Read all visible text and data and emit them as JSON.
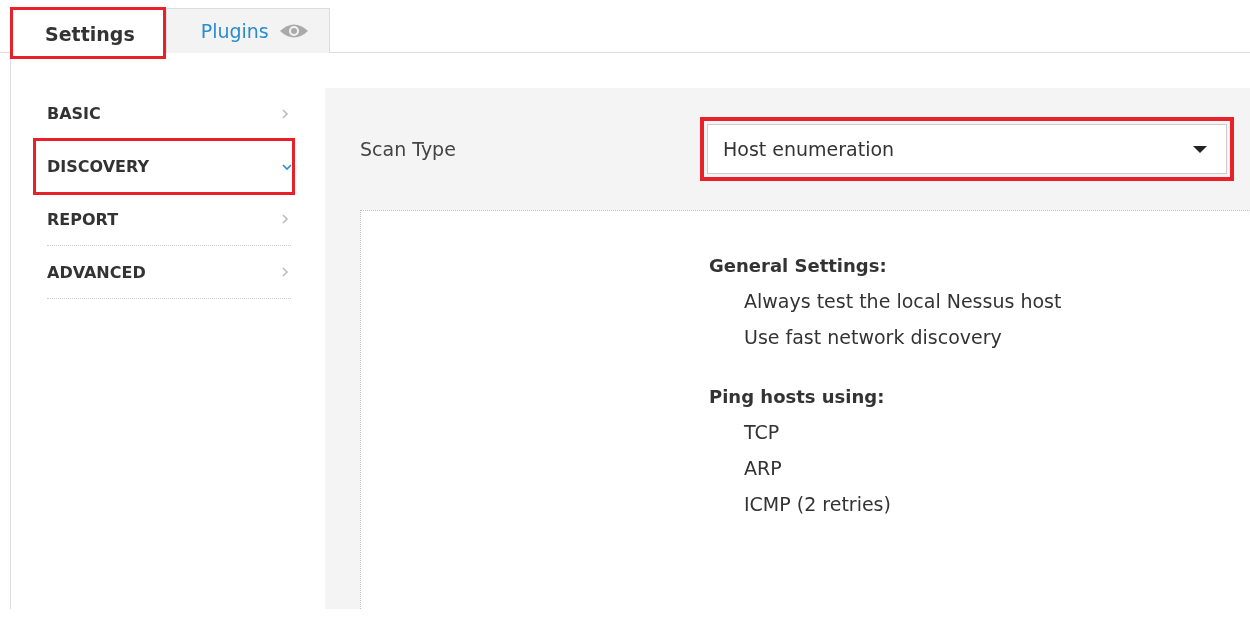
{
  "tabs": [
    {
      "label": "Settings",
      "selected": true,
      "highlighted": true,
      "kind": "plain"
    },
    {
      "label": "Plugins",
      "selected": false,
      "highlighted": false,
      "kind": "preview"
    }
  ],
  "sidebar": {
    "items": [
      {
        "label": "BASIC",
        "expanded": false,
        "highlighted": false
      },
      {
        "label": "DISCOVERY",
        "expanded": true,
        "highlighted": true
      },
      {
        "label": "REPORT",
        "expanded": false,
        "highlighted": false
      },
      {
        "label": "ADVANCED",
        "expanded": false,
        "highlighted": false
      }
    ]
  },
  "scan_type": {
    "label": "Scan Type",
    "value": "Host enumeration",
    "highlighted": true
  },
  "sections": [
    {
      "title": "General Settings:",
      "items": [
        "Always test the local Nessus host",
        "Use fast network discovery"
      ]
    },
    {
      "title": "Ping hosts using:",
      "items": [
        "TCP",
        "ARP",
        "ICMP (2 retries)"
      ]
    }
  ]
}
